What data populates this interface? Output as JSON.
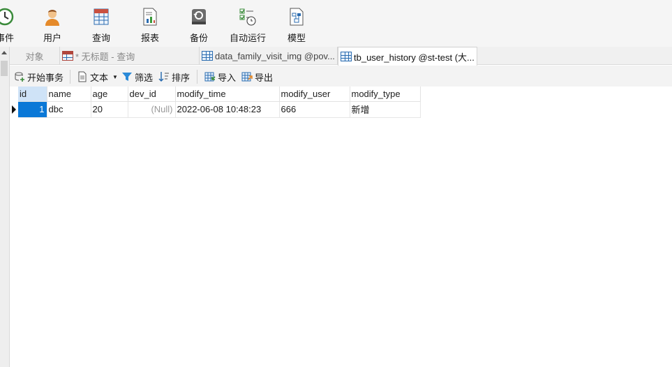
{
  "ribbon": {
    "items": [
      {
        "label": "事件",
        "icon": "clock-icon"
      },
      {
        "label": "用户",
        "icon": "user-icon"
      },
      {
        "label": "查询",
        "icon": "query-icon"
      },
      {
        "label": "报表",
        "icon": "report-icon"
      },
      {
        "label": "备份",
        "icon": "backup-icon"
      },
      {
        "label": "自动运行",
        "icon": "automation-icon"
      },
      {
        "label": "模型",
        "icon": "model-icon"
      }
    ]
  },
  "tabs": [
    {
      "label": "对象",
      "state": "inactive"
    },
    {
      "label": "* 无标题 - 查询",
      "state": "inactive"
    },
    {
      "label": "data_family_visit_img @pov...",
      "state": "inactive"
    },
    {
      "label": "tb_user_history @st-test (大...",
      "state": "active"
    }
  ],
  "toolbar": {
    "begin_transaction": "开始事务",
    "text": "文本",
    "filter": "筛选",
    "sort": "排序",
    "import": "导入",
    "export": "导出"
  },
  "table": {
    "columns": [
      "id",
      "name",
      "age",
      "dev_id",
      "modify_time",
      "modify_user",
      "modify_type"
    ],
    "rows": [
      {
        "id": "1",
        "name": "dbc",
        "age": "20",
        "dev_id": "(Null)",
        "modify_time": "2022-06-08 10:48:23",
        "modify_user": "666",
        "modify_type": "新增"
      }
    ]
  },
  "colors": {
    "selection": "#0a78d7",
    "header_selected": "#cfe3f7",
    "null_text": "#9a9a9a"
  }
}
